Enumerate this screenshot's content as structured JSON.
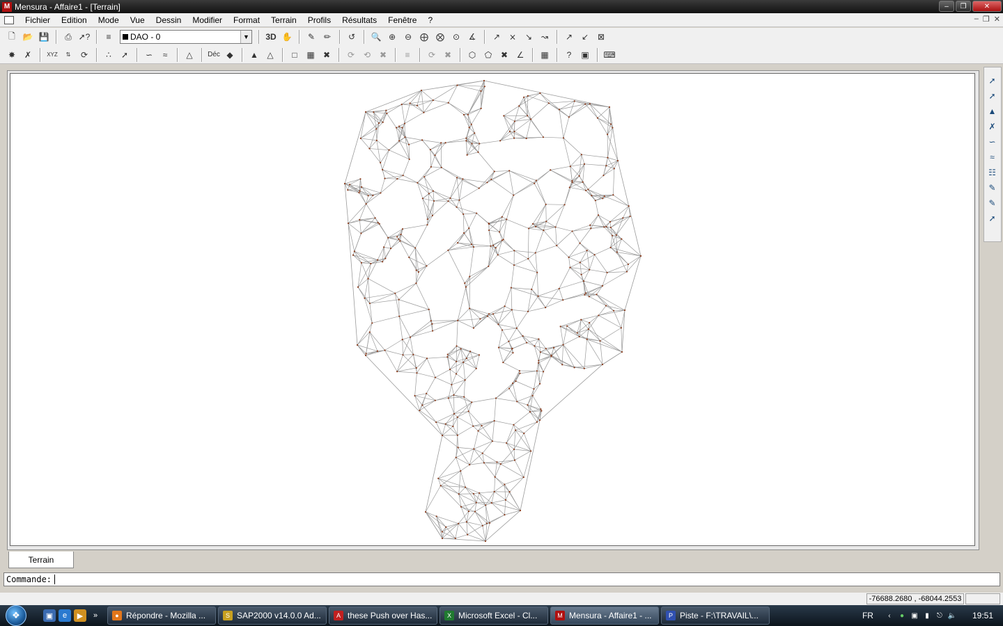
{
  "window": {
    "title": "Mensura - Affaire1 - [Terrain]",
    "app_icon": "mensura-logo-icon"
  },
  "menu": [
    "Fichier",
    "Edition",
    "Mode",
    "Vue",
    "Dessin",
    "Modifier",
    "Format",
    "Terrain",
    "Profils",
    "Résultats",
    "Fenêtre",
    "?"
  ],
  "toolbar": {
    "layer_value": "DAO - 0",
    "btn_3d": "3D",
    "btn_dec": "Déc",
    "btn_xyz": "XYZ"
  },
  "tabs": [
    {
      "label": "Terrain",
      "active": true
    }
  ],
  "command": {
    "label": "Commande:",
    "value": ""
  },
  "status": {
    "coords": "-76688.2680 , -68044.2553"
  },
  "taskbar": {
    "items": [
      {
        "label": "Répondre - Mozilla ...",
        "icon": "firefox-icon",
        "color": "#e2761b"
      },
      {
        "label": "SAP2000 v14.0.0 Ad...",
        "icon": "sap2000-icon",
        "color": "#c8a020"
      },
      {
        "label": "these Push over Has...",
        "icon": "pdf-icon",
        "color": "#c02020"
      },
      {
        "label": "Microsoft Excel - Cl...",
        "icon": "excel-icon",
        "color": "#207a30"
      },
      {
        "label": "Mensura - Affaire1 - ...",
        "icon": "mensura-icon",
        "color": "#b01010"
      },
      {
        "label": "Piste - F:\\TRAVAIL\\...",
        "icon": "piste-icon",
        "color": "#3050b0"
      }
    ],
    "lang": "FR",
    "time": "19:51"
  },
  "colors": {
    "mesh_line": "#9a9a9a",
    "mesh_point": "#8a3a1a"
  }
}
